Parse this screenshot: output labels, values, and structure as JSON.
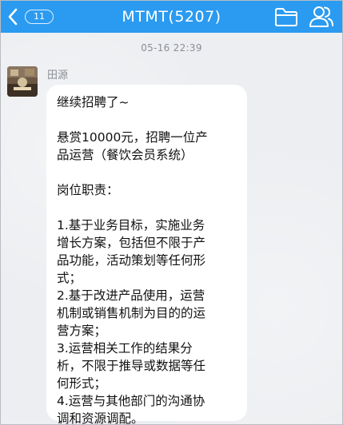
{
  "header": {
    "back_icon": "chevron-left-icon",
    "unread_count": "11",
    "title": "MTMT(5207)",
    "folder_icon": "folder-icon",
    "group_icon": "group-members-icon",
    "bar_color": "#2a9bf0"
  },
  "chat": {
    "timestamp": "05-16 22:39",
    "message": {
      "sender": "田源",
      "avatar_icon": "avatar",
      "lines": {
        "intro": "继续招聘了~",
        "reward_1": "悬赏10000元，招聘一位产",
        "reward_2": "品运营（餐饮会员系统）",
        "duties_heading": "岗位职责：",
        "d1_1": "1.基于业务目标，实施业务",
        "d1_2": "增长方案，包括但不限于产",
        "d1_3": "品功能，活动策划等任何形",
        "d1_4": "式；",
        "d2_1": "2.基于改进产品使用，运营",
        "d2_2": "机制或销售机制为目的的运",
        "d2_3": "营方案；",
        "d3_1": "3.运营相关工作的结果分",
        "d3_2": "析，不限于推导或数据等任",
        "d3_3": "何形式；",
        "d4_1": "4.运营与其他部门的沟通协",
        "d4_2": "调和资源调配。"
      }
    }
  }
}
